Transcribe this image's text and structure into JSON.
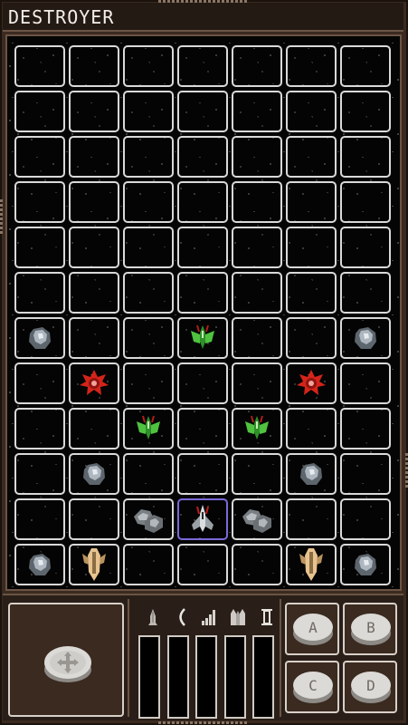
{
  "title": "DESTROYER",
  "board": {
    "cols": 7,
    "rows": 12,
    "pieces": [
      {
        "row": 6,
        "col": 0,
        "type": "asteroid-icon"
      },
      {
        "row": 6,
        "col": 3,
        "type": "green-fighter-icon"
      },
      {
        "row": 6,
        "col": 6,
        "type": "asteroid-icon"
      },
      {
        "row": 7,
        "col": 1,
        "type": "red-mine-icon"
      },
      {
        "row": 7,
        "col": 5,
        "type": "red-mine-icon"
      },
      {
        "row": 8,
        "col": 2,
        "type": "green-fighter-icon"
      },
      {
        "row": 8,
        "col": 4,
        "type": "green-fighter-icon"
      },
      {
        "row": 9,
        "col": 1,
        "type": "asteroid-icon"
      },
      {
        "row": 9,
        "col": 5,
        "type": "asteroid-icon"
      },
      {
        "row": 10,
        "col": 2,
        "type": "rock-cluster-icon"
      },
      {
        "row": 10,
        "col": 3,
        "type": "player-ship-icon"
      },
      {
        "row": 10,
        "col": 4,
        "type": "rock-cluster-icon"
      },
      {
        "row": 11,
        "col": 0,
        "type": "asteroid-icon"
      },
      {
        "row": 11,
        "col": 1,
        "type": "gold-cruiser-icon"
      },
      {
        "row": 11,
        "col": 5,
        "type": "gold-cruiser-icon"
      },
      {
        "row": 11,
        "col": 6,
        "type": "asteroid-icon"
      }
    ],
    "selected": {
      "row": 10,
      "col": 3
    }
  },
  "meters": [
    {
      "icon": "missile-icon",
      "level": 0
    },
    {
      "icon": "shield-arc-icon",
      "level": 0
    },
    {
      "icon": "signal-bars-icon",
      "level": 0
    },
    {
      "icon": "thruster-icon",
      "level": 0
    },
    {
      "icon": "hourglass-icon",
      "level": 0
    }
  ],
  "buttons": {
    "a": "A",
    "b": "B",
    "c": "C",
    "d": "D"
  },
  "colors": {
    "grid_line": "#d9d9d9",
    "selected_cell": "#7a6ad8",
    "frame": "#3a2a20"
  }
}
